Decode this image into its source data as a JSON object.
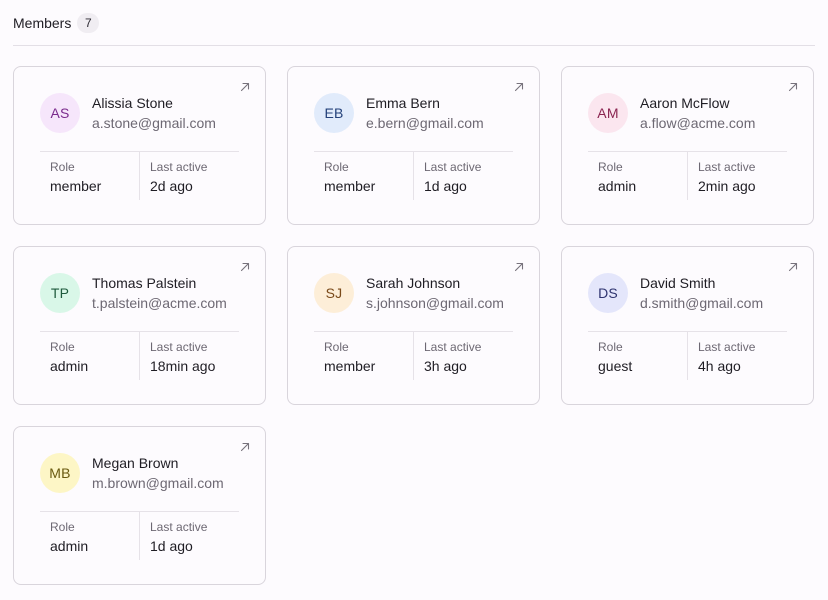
{
  "header": {
    "title": "Members",
    "count": "7"
  },
  "labels": {
    "role": "Role",
    "last_active": "Last active"
  },
  "colors": {
    "purple_bg": "#f6e6fb",
    "purple_fg": "#7a2a8c",
    "blue_bg": "#e1ebfb",
    "blue_fg": "#24417a",
    "pink_bg": "#fbe6ef",
    "pink_fg": "#8a2450",
    "green_bg": "#d9f7e8",
    "green_fg": "#1e5a3d",
    "orange_bg": "#fdeed8",
    "orange_fg": "#7a4a1a",
    "indigo_bg": "#e4e6fb",
    "indigo_fg": "#2f3470",
    "yellow_bg": "#fdf6c6",
    "yellow_fg": "#6a5a10"
  },
  "members": [
    {
      "initials": "AS",
      "name": "Alissia Stone",
      "email": "a.stone@gmail.com",
      "role": "member",
      "last_active": "2d ago",
      "avatar_bg": "#f6e6fb",
      "avatar_fg": "#7a2a8c"
    },
    {
      "initials": "EB",
      "name": "Emma Bern",
      "email": "e.bern@gmail.com",
      "role": "member",
      "last_active": "1d ago",
      "avatar_bg": "#e1ebfb",
      "avatar_fg": "#24417a"
    },
    {
      "initials": "AM",
      "name": "Aaron McFlow",
      "email": "a.flow@acme.com",
      "role": "admin",
      "last_active": "2min ago",
      "avatar_bg": "#fbe6ef",
      "avatar_fg": "#8a2450"
    },
    {
      "initials": "TP",
      "name": "Thomas Palstein",
      "email": "t.palstein@acme.com",
      "role": "admin",
      "last_active": "18min ago",
      "avatar_bg": "#d9f7e8",
      "avatar_fg": "#1e5a3d"
    },
    {
      "initials": "SJ",
      "name": "Sarah Johnson",
      "email": "s.johnson@gmail.com",
      "role": "member",
      "last_active": "3h ago",
      "avatar_bg": "#fdeed8",
      "avatar_fg": "#7a4a1a"
    },
    {
      "initials": "DS",
      "name": "David Smith",
      "email": "d.smith@gmail.com",
      "role": "guest",
      "last_active": "4h ago",
      "avatar_bg": "#e4e6fb",
      "avatar_fg": "#2f3470"
    },
    {
      "initials": "MB",
      "name": "Megan Brown",
      "email": "m.brown@gmail.com",
      "role": "admin",
      "last_active": "1d ago",
      "avatar_bg": "#fdf6c6",
      "avatar_fg": "#6a5a10"
    }
  ]
}
